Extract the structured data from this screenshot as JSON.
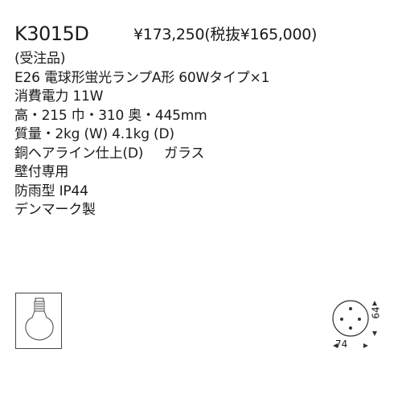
{
  "product": {
    "model": "K3015D",
    "price": "¥173,250",
    "price_tax_excluded": "(税抜¥165,000)"
  },
  "specs": [
    "(受注品)",
    "E26 電球形蛍光ランプA形 60Wタイプ×1",
    "消費電力 11W",
    "高・215 巾・310 奥・445mm",
    "質量・2kg (W) 4.1kg (D)",
    {
      "finish": "銅ヘアライン仕上(D)",
      "material": "ガラス"
    },
    "壁付専用",
    "防雨型 IP44",
    "デンマーク製"
  ],
  "figure": {
    "width_label": "74",
    "height_label": "64"
  },
  "icons": {
    "bulb": "light-bulb-icon",
    "mount": "wall-mount-plate-icon"
  }
}
